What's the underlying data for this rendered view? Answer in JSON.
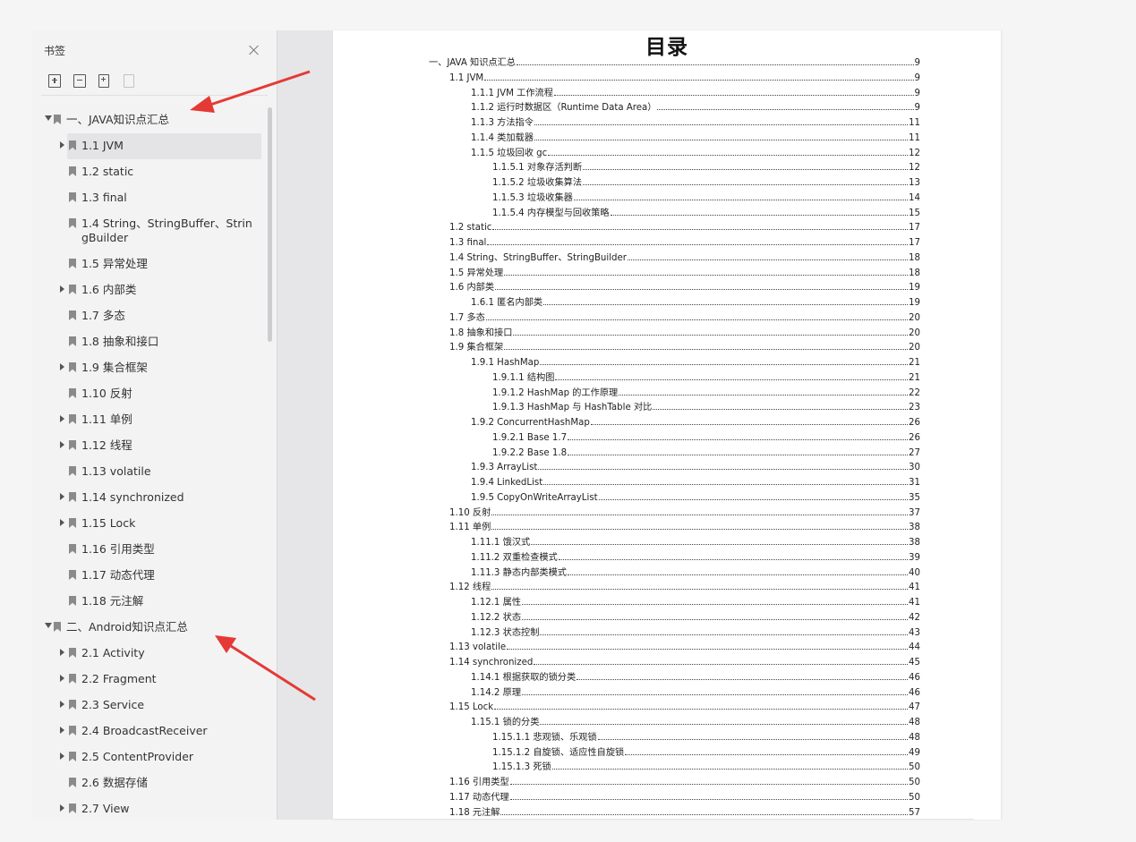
{
  "panel": {
    "title": "书签",
    "toolbar": [
      "expand-all-icon",
      "collapse-all-icon",
      "add-bookmark-icon",
      "delete-bookmark-icon"
    ],
    "tree": [
      {
        "label": "一、JAVA知识点汇总",
        "level": 0,
        "toggle": "expanded"
      },
      {
        "label": "1.1 JVM",
        "level": 1,
        "toggle": "collapsed",
        "selected": true
      },
      {
        "label": "1.2 static",
        "level": 1,
        "toggle": "none"
      },
      {
        "label": "1.3 final",
        "level": 1,
        "toggle": "none"
      },
      {
        "label": "1.4 String、StringBuffer、StringBuilder",
        "level": 1,
        "toggle": "none"
      },
      {
        "label": "1.5 异常处理",
        "level": 1,
        "toggle": "none"
      },
      {
        "label": "1.6 内部类",
        "level": 1,
        "toggle": "collapsed"
      },
      {
        "label": "1.7 多态",
        "level": 1,
        "toggle": "none"
      },
      {
        "label": "1.8 抽象和接口",
        "level": 1,
        "toggle": "none"
      },
      {
        "label": "1.9 集合框架",
        "level": 1,
        "toggle": "collapsed"
      },
      {
        "label": "1.10 反射",
        "level": 1,
        "toggle": "none"
      },
      {
        "label": "1.11 单例",
        "level": 1,
        "toggle": "collapsed"
      },
      {
        "label": "1.12 线程",
        "level": 1,
        "toggle": "collapsed"
      },
      {
        "label": "1.13 volatile",
        "level": 1,
        "toggle": "none"
      },
      {
        "label": "1.14 synchronized",
        "level": 1,
        "toggle": "collapsed"
      },
      {
        "label": "1.15 Lock",
        "level": 1,
        "toggle": "collapsed"
      },
      {
        "label": "1.16 引用类型",
        "level": 1,
        "toggle": "none"
      },
      {
        "label": "1.17 动态代理",
        "level": 1,
        "toggle": "none"
      },
      {
        "label": "1.18 元注解",
        "level": 1,
        "toggle": "none"
      },
      {
        "label": "二、Android知识点汇总",
        "level": 0,
        "toggle": "expanded"
      },
      {
        "label": "2.1 Activity",
        "level": 1,
        "toggle": "collapsed"
      },
      {
        "label": "2.2 Fragment",
        "level": 1,
        "toggle": "collapsed"
      },
      {
        "label": "2.3 Service",
        "level": 1,
        "toggle": "collapsed"
      },
      {
        "label": "2.4 BroadcastReceiver",
        "level": 1,
        "toggle": "collapsed"
      },
      {
        "label": "2.5 ContentProvider",
        "level": 1,
        "toggle": "collapsed"
      },
      {
        "label": "2.6 数据存储",
        "level": 1,
        "toggle": "none"
      },
      {
        "label": "2.7 View",
        "level": 1,
        "toggle": "collapsed"
      }
    ]
  },
  "document": {
    "title": "目录",
    "toc": [
      {
        "text": "一、JAVA 知识点汇总",
        "page": "9",
        "level": 0
      },
      {
        "text": "1.1 JVM",
        "page": "9",
        "level": 1
      },
      {
        "text": "1.1.1 JVM  工作流程",
        "page": "9",
        "level": 2
      },
      {
        "text": "1.1.2  运行时数据区（Runtime Data Area）",
        "page": "9",
        "level": 2
      },
      {
        "text": "1.1.3  方法指令",
        "page": "11",
        "level": 2
      },
      {
        "text": "1.1.4  类加载器",
        "page": "11",
        "level": 2
      },
      {
        "text": "1.1.5  垃圾回收  gc",
        "page": "12",
        "level": 2
      },
      {
        "text": "1.1.5.1  对象存活判断",
        "page": "12",
        "level": 3
      },
      {
        "text": "1.1.5.2  垃圾收集算法",
        "page": "13",
        "level": 3
      },
      {
        "text": "1.1.5.3  垃圾收集器",
        "page": "14",
        "level": 3
      },
      {
        "text": "1.1.5.4  内存模型与回收策略",
        "page": "15",
        "level": 3
      },
      {
        "text": "1.2 static",
        "page": "17",
        "level": 1
      },
      {
        "text": "1.3 final",
        "page": "17",
        "level": 1
      },
      {
        "text": "1.4 String、StringBuffer、StringBuilder",
        "page": "18",
        "level": 1
      },
      {
        "text": "1.5  异常处理",
        "page": "18",
        "level": 1
      },
      {
        "text": "1.6  内部类",
        "page": "19",
        "level": 1
      },
      {
        "text": "1.6.1  匿名内部类",
        "page": "19",
        "level": 2
      },
      {
        "text": "1.7  多态",
        "page": "20",
        "level": 1
      },
      {
        "text": "1.8  抽象和接口",
        "page": "20",
        "level": 1
      },
      {
        "text": "1.9  集合框架",
        "page": "20",
        "level": 1
      },
      {
        "text": "1.9.1 HashMap",
        "page": "21",
        "level": 2
      },
      {
        "text": "1.9.1.1  结构图",
        "page": "21",
        "level": 3
      },
      {
        "text": "1.9.1.2 HashMap  的工作原理",
        "page": "22",
        "level": 3
      },
      {
        "text": "1.9.1.3 HashMap  与  HashTable  对比",
        "page": "23",
        "level": 3
      },
      {
        "text": "1.9.2 ConcurrentHashMap",
        "page": "26",
        "level": 2
      },
      {
        "text": "1.9.2.1 Base 1.7",
        "page": "26",
        "level": 3
      },
      {
        "text": "1.9.2.2 Base 1.8",
        "page": "27",
        "level": 3
      },
      {
        "text": "1.9.3 ArrayList",
        "page": "30",
        "level": 2
      },
      {
        "text": "1.9.4 LinkedList",
        "page": "31",
        "level": 2
      },
      {
        "text": "1.9.5 CopyOnWriteArrayList",
        "page": "35",
        "level": 2
      },
      {
        "text": "1.10  反射",
        "page": "37",
        "level": 1
      },
      {
        "text": "1.11  单例",
        "page": "38",
        "level": 1
      },
      {
        "text": "1.11.1  饿汉式",
        "page": "38",
        "level": 2
      },
      {
        "text": "1.11.2  双重检查模式",
        "page": "39",
        "level": 2
      },
      {
        "text": "1.11.3  静态内部类模式",
        "page": "40",
        "level": 2
      },
      {
        "text": "1.12  线程",
        "page": "41",
        "level": 1
      },
      {
        "text": "1.12.1  属性",
        "page": "41",
        "level": 2
      },
      {
        "text": "1.12.2  状态",
        "page": "42",
        "level": 2
      },
      {
        "text": "1.12.3  状态控制",
        "page": "43",
        "level": 2
      },
      {
        "text": "1.13 volatile",
        "page": "44",
        "level": 1
      },
      {
        "text": "1.14 synchronized",
        "page": "45",
        "level": 1
      },
      {
        "text": "1.14.1  根据获取的锁分类",
        "page": "46",
        "level": 2
      },
      {
        "text": "1.14.2  原理",
        "page": "46",
        "level": 2
      },
      {
        "text": "1.15 Lock",
        "page": "47",
        "level": 1
      },
      {
        "text": "1.15.1  锁的分类",
        "page": "48",
        "level": 2
      },
      {
        "text": "1.15.1.1  悲观锁、乐观锁",
        "page": "48",
        "level": 3
      },
      {
        "text": "1.15.1.2  自旋锁、适应性自旋锁",
        "page": "49",
        "level": 3
      },
      {
        "text": "1.15.1.3  死锁",
        "page": "50",
        "level": 3
      },
      {
        "text": "1.16  引用类型",
        "page": "50",
        "level": 1
      },
      {
        "text": "1.17  动态代理",
        "page": "50",
        "level": 1
      },
      {
        "text": "1.18  元注解",
        "page": "57",
        "level": 1
      }
    ]
  },
  "colors": {
    "background": "#f5f5f6",
    "panel": "#f3f3f4",
    "selected_row": "#e4e4e7",
    "arrow": "#e53935"
  }
}
